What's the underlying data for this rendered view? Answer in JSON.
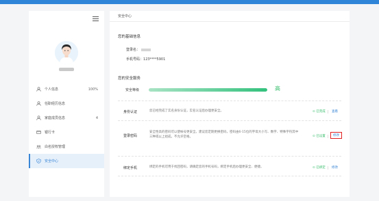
{
  "sidebar": {
    "items": [
      {
        "label": "个人信息",
        "value": "100%",
        "icon": "user-icon"
      },
      {
        "label": "任职经历信息",
        "value": "",
        "icon": "user-icon"
      },
      {
        "label": "家庭成员信息",
        "value": "4",
        "icon": "user-icon"
      },
      {
        "label": "银行卡",
        "value": "",
        "icon": "card-icon"
      },
      {
        "label": "白名授权管理",
        "value": "",
        "icon": "group-icon"
      },
      {
        "label": "安全中心",
        "value": "",
        "icon": "shield-icon",
        "active": true
      }
    ]
  },
  "main": {
    "header": "安全中心",
    "basic": {
      "title": "您的基础信息",
      "login_name_label": "登录名：",
      "phone_label": "手机号码：",
      "phone_value": "123****5901"
    },
    "security": {
      "title": "您的安全服务",
      "level_label": "安全等级",
      "level_text": "高",
      "level_fill": 1.0,
      "rows": [
        {
          "label": "身份认证",
          "desc": "您已经完成了实名身份认证，实名认证后办理更安全。",
          "status": "已完成",
          "link": "查看"
        },
        {
          "label": "登录密码",
          "desc": "安全性高的密码可以使帐号更安全。建议您定期更换密码，密码由6-15位的字母大小写、数字、特殊字符其中三种或以上组成，不允许空格。",
          "status": "已设置",
          "link": "修改"
        },
        {
          "label": "绑定手机",
          "desc": "绑定的手机可用于找回密码，请确定您的手机号码，绑定手机后办理更安全、便捷。",
          "status": "已绑定",
          "link": "修改"
        }
      ]
    }
  },
  "colors": {
    "primary": "#2f86d8",
    "success": "#3bbf6e",
    "highlight": "#e02020"
  }
}
